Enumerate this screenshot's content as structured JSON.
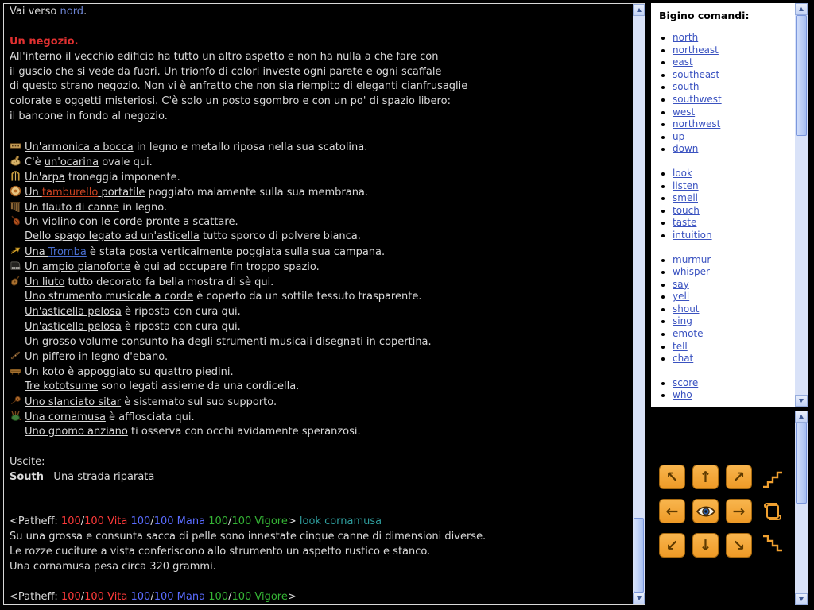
{
  "palette": {
    "main_background": "#000000",
    "main_text": "#d9d9d9",
    "room_title_red": "#e03030",
    "direction_blue": "#6f86d6",
    "item_link_red": "#cc4422",
    "item_link_blue": "#4a6fd0",
    "vita_red": "#ff3a3a",
    "mana_blue": "#5a6cff",
    "vigore_green": "#35b535",
    "command_echo_teal": "#2f9e9e",
    "command_link_blue": "#3a52c0",
    "button_orange": "#f0a030",
    "panel_background": "#ffffff"
  },
  "main": {
    "lines": [
      {
        "t": "seg",
        "segs": [
          {
            "text": "Vai verso "
          },
          {
            "text": "nord",
            "color": "#6f86d6",
            "name": "direction-text"
          },
          {
            "text": "."
          }
        ]
      },
      {
        "t": "blank"
      },
      {
        "t": "seg",
        "segs": [
          {
            "text": "Un negozio.",
            "color": "#e03030",
            "bold": true,
            "name": "room-title"
          }
        ]
      },
      {
        "t": "seg",
        "segs": [
          {
            "text": "All'interno il vecchio edificio ha tutto un altro aspetto e non ha nulla a che fare con"
          }
        ]
      },
      {
        "t": "seg",
        "segs": [
          {
            "text": "il guscio che si vede da fuori. Un trionfo di colori investe ogni parete e ogni scaffale"
          }
        ]
      },
      {
        "t": "seg",
        "segs": [
          {
            "text": "di questo strano negozio. Non vi è anfratto che non sia riempito di eleganti cianfrusaglie"
          }
        ]
      },
      {
        "t": "seg",
        "segs": [
          {
            "text": "colorate e oggetti misteriosi. C'è solo un posto sgombro e con un po' di spazio libero:"
          }
        ]
      },
      {
        "t": "seg",
        "segs": [
          {
            "text": "il bancone in fondo al negozio."
          }
        ]
      },
      {
        "t": "blank"
      },
      {
        "t": "item",
        "icon": "harmonica-icon",
        "segs": [
          {
            "text": "Un'armonica a bocca",
            "link": true
          },
          {
            "text": " in legno e metallo riposa nella sua scatolina."
          }
        ]
      },
      {
        "t": "item",
        "icon": "ocarina-icon",
        "segs": [
          {
            "text": "C'è "
          },
          {
            "text": "un'ocarina",
            "link": true
          },
          {
            "text": " ovale qui."
          }
        ]
      },
      {
        "t": "item",
        "icon": "harp-icon",
        "segs": [
          {
            "text": "Un'arpa",
            "link": true
          },
          {
            "text": " troneggia imponente."
          }
        ]
      },
      {
        "t": "item",
        "icon": "tambourine-icon",
        "segs": [
          {
            "text": "Un ",
            "link": true
          },
          {
            "text": "tamburello",
            "link": true,
            "color": "#cc4422"
          },
          {
            "text": " portatile",
            "link": true
          },
          {
            "text": " poggiato malamente sulla sua membrana."
          }
        ]
      },
      {
        "t": "item",
        "icon": "panflute-icon",
        "segs": [
          {
            "text": "Un flauto di canne",
            "link": true
          },
          {
            "text": " in legno."
          }
        ]
      },
      {
        "t": "item",
        "icon": "violin-icon",
        "segs": [
          {
            "text": "Un violino",
            "link": true
          },
          {
            "text": " con le corde pronte a scattare."
          }
        ]
      },
      {
        "t": "item",
        "icon": "",
        "segs": [
          {
            "text": "Dello spago legato ad un'asticella",
            "link": true
          },
          {
            "text": " tutto sporco di polvere bianca."
          }
        ]
      },
      {
        "t": "item",
        "icon": "trumpet-icon",
        "segs": [
          {
            "text": "Una ",
            "link": true
          },
          {
            "text": "Tromba",
            "link": true,
            "color": "#4a6fd0"
          },
          {
            "text": " è stata posta verticalmente poggiata sulla sua campana."
          }
        ]
      },
      {
        "t": "item",
        "icon": "piano-icon",
        "segs": [
          {
            "text": "Un ampio pianoforte",
            "link": true
          },
          {
            "text": " è qui ad occupare fin troppo spazio."
          }
        ]
      },
      {
        "t": "item",
        "icon": "lute-icon",
        "segs": [
          {
            "text": "Un liuto",
            "link": true
          },
          {
            "text": " tutto decorato fa bella mostra di sè qui."
          }
        ]
      },
      {
        "t": "item",
        "icon": "",
        "segs": [
          {
            "text": "Uno strumento musicale a corde",
            "link": true
          },
          {
            "text": " è coperto da un sottile tessuto trasparente."
          }
        ]
      },
      {
        "t": "item",
        "icon": "",
        "segs": [
          {
            "text": "Un'asticella pelosa",
            "link": true
          },
          {
            "text": " è riposta con cura qui."
          }
        ]
      },
      {
        "t": "item",
        "icon": "",
        "segs": [
          {
            "text": "Un'asticella pelosa",
            "link": true
          },
          {
            "text": " è riposta con cura qui."
          }
        ]
      },
      {
        "t": "item",
        "icon": "",
        "segs": [
          {
            "text": "Un grosso volume consunto",
            "link": true
          },
          {
            "text": " ha degli strumenti musicali disegnati in copertina."
          }
        ]
      },
      {
        "t": "item",
        "icon": "fife-icon",
        "segs": [
          {
            "text": "Un piffero",
            "link": true
          },
          {
            "text": " in legno d'ebano."
          }
        ]
      },
      {
        "t": "item",
        "icon": "koto-icon",
        "segs": [
          {
            "text": "Un koto",
            "link": true
          },
          {
            "text": " è appoggiato su quattro piedini."
          }
        ]
      },
      {
        "t": "item",
        "icon": "",
        "segs": [
          {
            "text": "Tre kototsume",
            "link": true
          },
          {
            "text": " sono legati assieme da una cordicella."
          }
        ]
      },
      {
        "t": "item",
        "icon": "sitar-icon",
        "segs": [
          {
            "text": "Uno slanciato sitar",
            "link": true
          },
          {
            "text": " è sistemato sul suo supporto."
          }
        ]
      },
      {
        "t": "item",
        "icon": "bagpipe-icon",
        "segs": [
          {
            "text": "Una cornamusa",
            "link": true
          },
          {
            "text": " è afflosciata qui."
          }
        ]
      },
      {
        "t": "item",
        "icon": "",
        "segs": [
          {
            "text": "Uno gnomo anziano",
            "link": true
          },
          {
            "text": " ti osserva con occhi avidamente speranzosi."
          }
        ]
      },
      {
        "t": "blank"
      },
      {
        "t": "seg",
        "segs": [
          {
            "text": "Uscite:"
          }
        ]
      },
      {
        "t": "seg",
        "segs": [
          {
            "text": "South",
            "link": true,
            "bold": true,
            "name": "exit-link-south"
          },
          {
            "text": "   Una strada riparata"
          }
        ]
      },
      {
        "t": "blank"
      },
      {
        "t": "blank"
      },
      {
        "t": "seg",
        "segs": [
          {
            "text": "<Patheff: "
          },
          {
            "text": "100",
            "color": "#ff3a3a"
          },
          {
            "text": "/"
          },
          {
            "text": "100 Vita",
            "color": "#ff3a3a"
          },
          {
            "text": " "
          },
          {
            "text": "100",
            "color": "#5a6cff"
          },
          {
            "text": "/"
          },
          {
            "text": "100 Mana",
            "color": "#5a6cff"
          },
          {
            "text": " "
          },
          {
            "text": "100",
            "color": "#35b535"
          },
          {
            "text": "/"
          },
          {
            "text": "100 Vigore",
            "color": "#35b535"
          },
          {
            "text": "> "
          },
          {
            "text": "look cornamusa",
            "color": "#2f9e9e",
            "name": "command-echo"
          }
        ]
      },
      {
        "t": "seg",
        "segs": [
          {
            "text": "Su una grossa e consunta sacca di pelle sono innestate cinque canne di dimensioni diverse."
          }
        ]
      },
      {
        "t": "seg",
        "segs": [
          {
            "text": "Le rozze cuciture a vista conferiscono allo strumento un aspetto rustico e stanco."
          }
        ]
      },
      {
        "t": "seg",
        "segs": [
          {
            "text": "Una cornamusa pesa circa 320 grammi."
          }
        ]
      },
      {
        "t": "blank"
      },
      {
        "t": "seg",
        "segs": [
          {
            "text": "<Patheff: "
          },
          {
            "text": "100",
            "color": "#ff3a3a"
          },
          {
            "text": "/"
          },
          {
            "text": "100 Vita",
            "color": "#ff3a3a"
          },
          {
            "text": " "
          },
          {
            "text": "100",
            "color": "#5a6cff"
          },
          {
            "text": "/"
          },
          {
            "text": "100 Mana",
            "color": "#5a6cff"
          },
          {
            "text": " "
          },
          {
            "text": "100",
            "color": "#35b535"
          },
          {
            "text": "/"
          },
          {
            "text": "100 Vigore",
            "color": "#35b535"
          },
          {
            "text": ">"
          }
        ]
      }
    ]
  },
  "commands": {
    "title": "Bigino comandi:",
    "groups": [
      [
        "north",
        "northeast",
        "east",
        "southeast",
        "south",
        "southwest",
        "west",
        "northwest",
        "up",
        "down"
      ],
      [
        "look",
        "listen",
        "smell",
        "touch",
        "taste",
        "intuition"
      ],
      [
        "murmur",
        "whisper",
        "say",
        "yell",
        "shout",
        "sing",
        "emote",
        "tell",
        "chat"
      ],
      [
        "score",
        "who"
      ]
    ]
  },
  "navpad": {
    "buttons": [
      {
        "name": "northwest-button",
        "char": "↖",
        "style": "orange"
      },
      {
        "name": "north-button",
        "char": "↑",
        "style": "orange"
      },
      {
        "name": "northeast-button",
        "char": "↗",
        "style": "orange"
      },
      {
        "name": "stairs-up-button",
        "icon": "stairs-up-icon",
        "style": "plain"
      },
      {
        "name": "west-button",
        "char": "←",
        "style": "orange"
      },
      {
        "name": "look-button",
        "icon": "eye-icon",
        "style": "orange"
      },
      {
        "name": "east-button",
        "char": "→",
        "style": "orange"
      },
      {
        "name": "scroll-button",
        "icon": "scroll-icon",
        "style": "plain"
      },
      {
        "name": "southwest-button",
        "char": "↙",
        "style": "orange"
      },
      {
        "name": "south-button",
        "char": "↓",
        "style": "orange"
      },
      {
        "name": "southeast-button",
        "char": "↘",
        "style": "orange"
      },
      {
        "name": "stairs-down-button",
        "icon": "stairs-down-icon",
        "style": "plain"
      }
    ]
  }
}
